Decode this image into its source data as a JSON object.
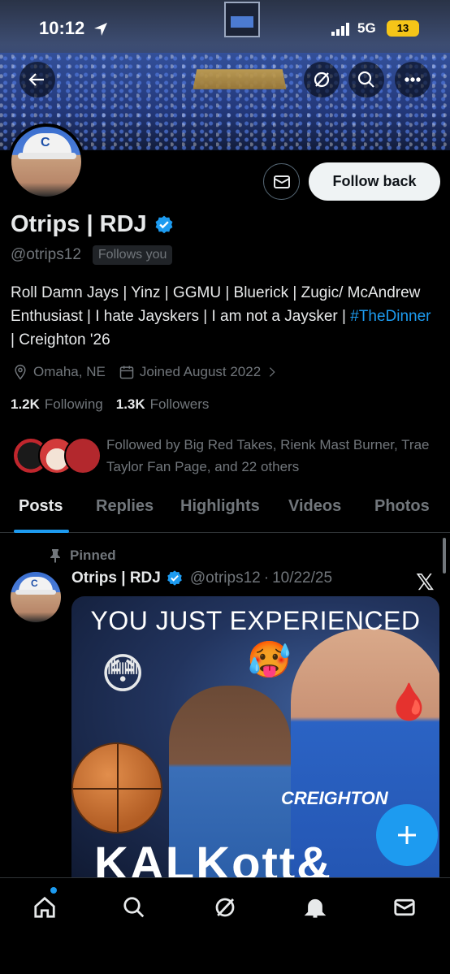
{
  "status_bar": {
    "time": "10:12",
    "network": "5G",
    "battery": "13"
  },
  "header": {
    "back_icon": "arrow-left-icon",
    "grok_icon": "grok-icon",
    "search_icon": "search-icon",
    "more_icon": "more-icon"
  },
  "profile": {
    "display_name": "Otrips | RDJ",
    "handle": "@otrips12",
    "follows_you": "Follows you",
    "follow_back_label": "Follow back",
    "bio_part1": "Roll Damn Jays | Yinz | GGMU | Bluerick | Zugic/ McAndrew Enthusiast | I hate Jayskers | I am not a Jaysker | ",
    "bio_hashtag": "#TheDinner",
    "bio_part2": " | Creighton '26",
    "location": "Omaha, NE",
    "joined": "Joined August 2022",
    "following_count": "1.2K",
    "following_label": "Following",
    "followers_count": "1.3K",
    "followers_label": "Followers",
    "followed_by": "Followed by Big Red Takes, Rienk Mast Burner, Trae Taylor Fan Page, and 22 others"
  },
  "tabs": [
    {
      "label": "Posts",
      "active": true
    },
    {
      "label": "Replies",
      "active": false
    },
    {
      "label": "Highlights",
      "active": false
    },
    {
      "label": "Videos",
      "active": false
    },
    {
      "label": "Photos",
      "active": false
    }
  ],
  "post": {
    "pinned_label": "Pinned",
    "author_name": "Otrips | RDJ",
    "author_handle": "@otrips12",
    "separator": "·",
    "date": "10/22/25",
    "media_caption": "YOU JUST EXPERIENCED",
    "media_jersey_text": "CREIGHTON",
    "media_big_text": "KALKott& BALL",
    "media_emojis": [
      "😳",
      "🥵",
      "🩸"
    ]
  },
  "colors": {
    "accent": "#1d9bf0",
    "muted": "#71767b",
    "text": "#e7e9ea",
    "background": "#000000"
  },
  "bottom_nav": [
    "home-icon",
    "search-icon",
    "grok-icon",
    "notifications-icon",
    "messages-icon"
  ]
}
